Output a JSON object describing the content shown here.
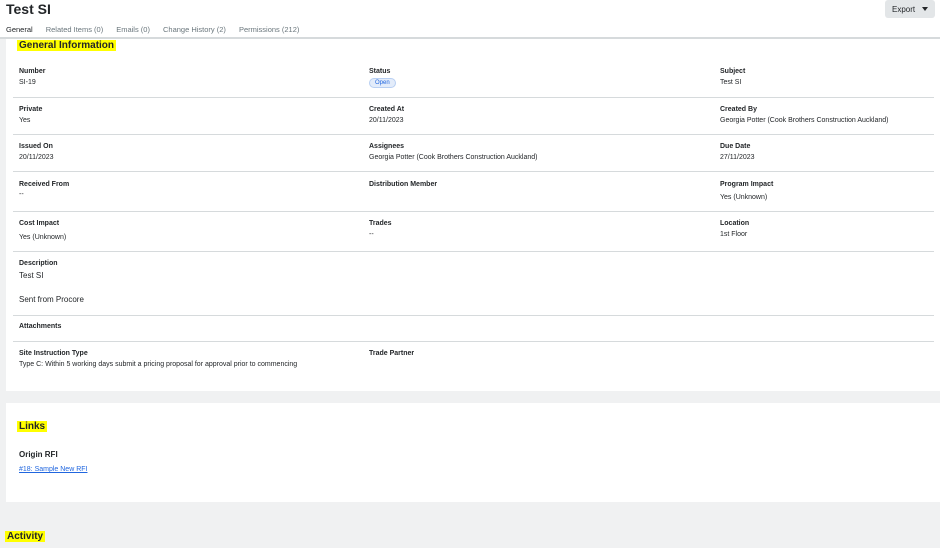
{
  "header": {
    "title": "Test SI",
    "export_label": "Export",
    "tabs": [
      {
        "label": "General"
      },
      {
        "label": "Related Items (0)"
      },
      {
        "label": "Emails (0)"
      },
      {
        "label": "Change History (2)"
      },
      {
        "label": "Permissions (212)"
      }
    ]
  },
  "general": {
    "title": "General Information",
    "number": {
      "label": "Number",
      "value": "SI-19"
    },
    "status": {
      "label": "Status",
      "value": "Open"
    },
    "subject": {
      "label": "Subject",
      "value": "Test SI"
    },
    "private": {
      "label": "Private",
      "value": "Yes"
    },
    "created_at": {
      "label": "Created At",
      "value": "20/11/2023"
    },
    "created_by": {
      "label": "Created By",
      "value": "Georgia Potter (Cook Brothers Construction Auckland)"
    },
    "issued_on": {
      "label": "Issued On",
      "value": "20/11/2023"
    },
    "assignees": {
      "label": "Assignees",
      "value": "Georgia Potter (Cook Brothers Construction Auckland)"
    },
    "due_date": {
      "label": "Due Date",
      "value": "27/11/2023"
    },
    "received_from": {
      "label": "Received From",
      "value": "--"
    },
    "distribution_member": {
      "label": "Distribution Member",
      "value": ""
    },
    "program_impact": {
      "label": "Program Impact",
      "value": "Yes (Unknown)"
    },
    "cost_impact": {
      "label": "Cost Impact",
      "value": "Yes (Unknown)"
    },
    "trades": {
      "label": "Trades",
      "value": "--"
    },
    "location": {
      "label": "Location",
      "value": "1st Floor"
    },
    "description": {
      "label": "Description",
      "line1": "Test SI",
      "line2": "Sent from Procore"
    },
    "attachments": {
      "label": "Attachments"
    },
    "si_type": {
      "label": "Site Instruction Type",
      "value": "Type C: Within 5 working days submit a pricing proposal for approval prior to commencing"
    },
    "trade_partner": {
      "label": "Trade Partner",
      "value": ""
    }
  },
  "links": {
    "title": "Links",
    "origin_rfi_label": "Origin RFI",
    "origin_rfi_link": "#18: Sample New RFI"
  },
  "activity": {
    "title": "Activity"
  }
}
